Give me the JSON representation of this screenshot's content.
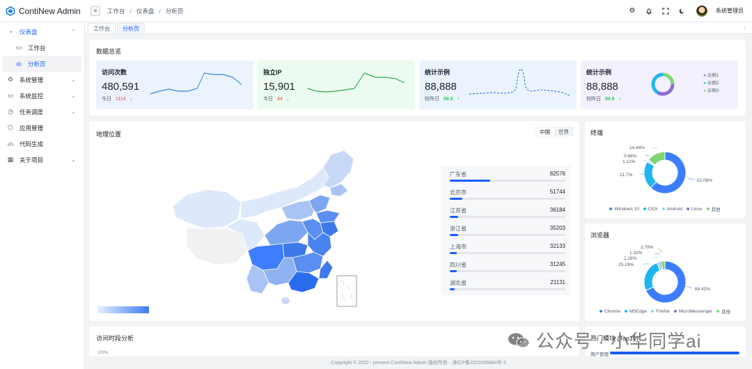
{
  "app": {
    "title": "ContiNew Admin"
  },
  "header": {
    "breadcrumb": [
      "工作台",
      "仪表盘",
      "分析页"
    ],
    "user_name": "系统管理员"
  },
  "sidebar": {
    "items": [
      {
        "label": "仪表盘",
        "icon": "dashboard-icon",
        "expanded": true
      },
      {
        "label": "工作台",
        "icon": "monitor-icon",
        "sub": true
      },
      {
        "label": "分析页",
        "icon": "bar-chart-icon",
        "sub": true,
        "active": true
      },
      {
        "label": "系统管理",
        "icon": "gear-icon"
      },
      {
        "label": "系统监控",
        "icon": "screen-icon"
      },
      {
        "label": "任务调度",
        "icon": "clock-icon"
      },
      {
        "label": "应用管理",
        "icon": "cube-icon"
      },
      {
        "label": "代码生成",
        "icon": "code-icon"
      },
      {
        "label": "关于项目",
        "icon": "apps-icon"
      }
    ]
  },
  "tabs": [
    {
      "label": "工作台"
    },
    {
      "label": "分析页",
      "active": true
    }
  ],
  "overview": {
    "title": "数据总览",
    "cards": [
      {
        "title": "访问次数",
        "value": "480,591",
        "sub_label": "今日",
        "sub_value": "1114",
        "trend": "down",
        "bg": "#ebf3fd"
      },
      {
        "title": "独立IP",
        "value": "15,901",
        "sub_label": "今日",
        "sub_value": "44",
        "trend": "down",
        "bg": "#ebfbef"
      },
      {
        "title": "统计示例",
        "value": "88,888",
        "sub_label": "较昨日",
        "sub_value": "88.8",
        "trend": "up",
        "bg": "#ebf4fe"
      },
      {
        "title": "统计示例",
        "value": "88,888",
        "sub_label": "较昨日",
        "sub_value": "88.8",
        "trend": "up",
        "bg": "#f2f1fd"
      }
    ],
    "mini_legend": [
      "示例1",
      "示例2",
      "示例3"
    ]
  },
  "geo": {
    "title": "地理位置",
    "toggle": [
      "中国",
      "世界"
    ],
    "ranking": [
      {
        "name": "广东省",
        "value": "82576",
        "ratio": 0.35
      },
      {
        "name": "北京市",
        "value": "51744",
        "ratio": 0.11
      },
      {
        "name": "江苏省",
        "value": "36184",
        "ratio": 0.07
      },
      {
        "name": "浙江省",
        "value": "35203",
        "ratio": 0.07
      },
      {
        "name": "上海市",
        "value": "32133",
        "ratio": 0.06
      },
      {
        "name": "四川省",
        "value": "31245",
        "ratio": 0.06
      },
      {
        "name": "湖北省",
        "value": "21131",
        "ratio": 0.04
      }
    ]
  },
  "terminal": {
    "title": "终端",
    "slices": [
      {
        "name": "Windows 10",
        "value": 62.06,
        "label": "62.06%",
        "color": "#3c7eff"
      },
      {
        "name": "OSX",
        "value": 21.7,
        "label": "21.7%",
        "color": "#1fb6f0"
      },
      {
        "name": "Android",
        "value": 1.12,
        "label": "1.12%",
        "color": "#8cd6f2"
      },
      {
        "name": "Linux",
        "value": 0.68,
        "label": "0.68%",
        "color": "#8b6bd6"
      },
      {
        "name": "其他",
        "value": 14.44,
        "label": "14.44%",
        "color": "#7ed672"
      }
    ]
  },
  "browser": {
    "title": "浏览器",
    "slices": [
      {
        "name": "Chrome",
        "value": 68.42,
        "label": "68.42%",
        "color": "#3c7eff"
      },
      {
        "name": "MSEdge",
        "value": 25.19,
        "label": "25.19%",
        "color": "#1fb6f0"
      },
      {
        "name": "Firefox",
        "value": 2.28,
        "label": "2.28%",
        "color": "#8cd6f2"
      },
      {
        "name": "MicroMessenger",
        "value": 1.32,
        "label": "1.32%",
        "color": "#8b6bd6"
      },
      {
        "name": "其他",
        "value": 2.79,
        "label": "2.79%",
        "color": "#7ed672"
      }
    ]
  },
  "time_analysis": {
    "title": "访问时段分析",
    "y_top": "100%"
  },
  "hot_modules": {
    "title": "热门模块 (Top10)",
    "first_row": "用户管理"
  },
  "footer": {
    "text": "Copyright © 2022 - present ContiNew Admin 版权所有 · 津ICP备2022005864号-3"
  },
  "watermark": {
    "text": "公众号 · 小华同学ai"
  }
}
